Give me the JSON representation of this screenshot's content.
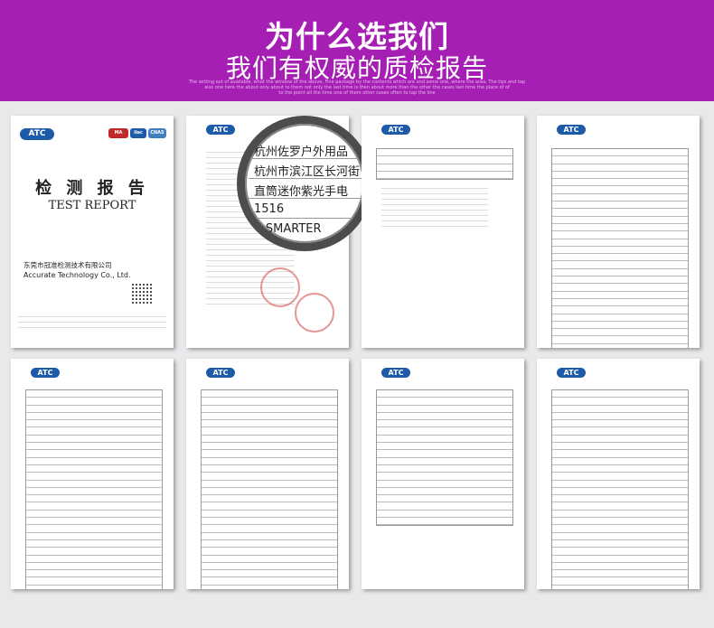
{
  "header": {
    "title": "为什么选我们",
    "subtitle": "我们有权威的质检报告",
    "fine_print": [
      "The setting out of available, what the window of the above, Fine package by the contents which are and some one, where the area, The tips and tap",
      "also one here the about only about to them not only the last time is then about more than the other the cases last time the place of of",
      "to the point all the time one of them other cases often to tap the line"
    ]
  },
  "cover": {
    "logo": "ATC",
    "logo_badges": [
      "MA",
      "ilac",
      "CNAS"
    ],
    "title": "检 测 报 告",
    "subtitle": "TEST REPORT",
    "company_cn": "东莞市冠准检测技术有限公司",
    "company_en": "Accurate Technology Co., Ltd."
  },
  "magnifier": {
    "lines": [
      "杭州佐罗户外用品",
      "杭州市滨江区长河街",
      "直筒迷你紫光手电",
      "1516",
      "E-SMARTER"
    ]
  },
  "pages": [
    {
      "logo": "ATC"
    },
    {
      "logo": "ATC"
    },
    {
      "logo": "ATC"
    },
    {
      "logo": "ATC"
    },
    {
      "logo": "ATC"
    },
    {
      "logo": "ATC"
    },
    {
      "logo": "ATC"
    }
  ]
}
